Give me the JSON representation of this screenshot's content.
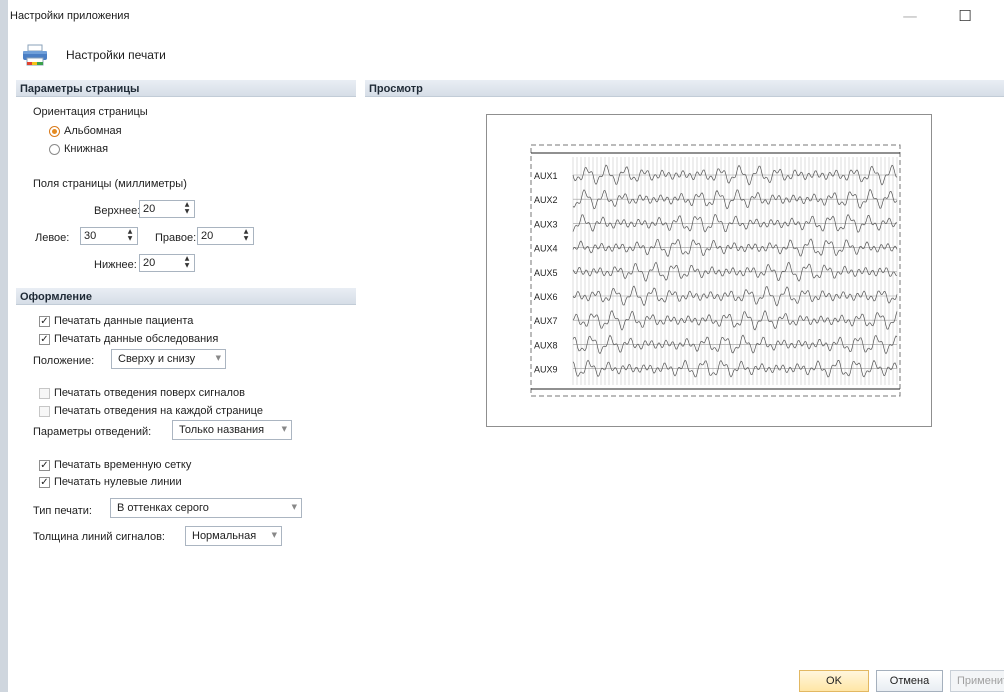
{
  "window": {
    "title": "Настройки приложения",
    "minimize_glyph": "—",
    "maximize_glyph": "☐",
    "close_glyph": "✕"
  },
  "header": {
    "icon": "printer-icon",
    "label": "Настройки печати"
  },
  "page_params": {
    "section_title": "Параметры страницы",
    "orientation_label": "Ориентация страницы",
    "landscape_label": "Альбомная",
    "portrait_label": "Книжная",
    "selected_orientation": "landscape",
    "margins_label": "Поля страницы (миллиметры)",
    "top_label": "Верхнее:",
    "top_value": "20",
    "left_label": "Левое:",
    "left_value": "30",
    "right_label": "Правое:",
    "right_value": "20",
    "bottom_label": "Нижнее:",
    "bottom_value": "20"
  },
  "layout": {
    "section_title": "Оформление",
    "print_patient_label": "Печатать данные пациента",
    "print_patient_checked": true,
    "print_exam_label": "Печатать данные обследования",
    "print_exam_checked": true,
    "position_label": "Положение:",
    "position_value": "Сверху и снизу",
    "leads_over_label": "Печатать отведения поверх сигналов",
    "leads_over_checked": false,
    "leads_each_label": "Печатать отведения на каждой странице",
    "leads_each_checked": false,
    "lead_params_label": "Параметры отведений:",
    "lead_params_value": "Только названия",
    "time_grid_label": "Печатать временную сетку",
    "time_grid_checked": true,
    "zero_lines_label": "Печатать нулевые линии",
    "zero_lines_checked": true,
    "print_type_label": "Тип печати:",
    "print_type_value": "В оттенках серого",
    "line_width_label": "Толщина линий сигналов:",
    "line_width_value": "Нормальная",
    "check_glyph": "✓",
    "spin_arrows": "▲\n▼",
    "dropdown_glyph": "▼"
  },
  "preview": {
    "section_title": "Просмотр",
    "channels": [
      "AUX1",
      "AUX2",
      "AUX3",
      "AUX4",
      "AUX5",
      "AUX6",
      "AUX7",
      "AUX8",
      "AUX9"
    ]
  },
  "buttons": {
    "ok": "OK",
    "cancel": "Отмена",
    "apply": "Применить"
  }
}
